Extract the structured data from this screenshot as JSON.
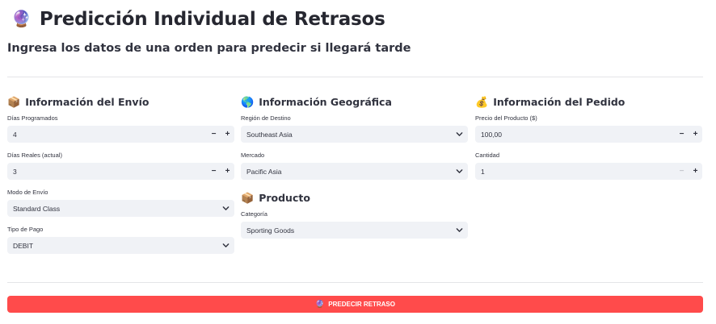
{
  "header": {
    "title_emoji": "🔮",
    "title": "Predicción Individual de Retrasos",
    "subtitle": "Ingresa los datos de una orden para predecir si llegará tarde"
  },
  "envio": {
    "emoji": "📦",
    "heading": "Información del Envío",
    "dias_programados": {
      "label": "Días Programados",
      "value": "4"
    },
    "dias_reales": {
      "label": "Días Reales (actual)",
      "value": "3"
    },
    "modo_envio": {
      "label": "Modo de Envío",
      "value": "Standard Class"
    },
    "tipo_pago": {
      "label": "Tipo de Pago",
      "value": "DEBIT"
    }
  },
  "geografica": {
    "emoji": "🌎",
    "heading": "Información Geográfica",
    "region": {
      "label": "Región de Destino",
      "value": "Southeast Asia"
    },
    "mercado": {
      "label": "Mercado",
      "value": "Pacific Asia"
    }
  },
  "producto": {
    "emoji": "📦",
    "heading": "Producto",
    "categoria": {
      "label": "Categoría",
      "value": "Sporting Goods"
    }
  },
  "pedido": {
    "emoji": "💰",
    "heading": "Información del Pedido",
    "precio": {
      "label": "Precio del Producto ($)",
      "value": "100,00"
    },
    "cantidad": {
      "label": "Cantidad",
      "value": "1"
    }
  },
  "stepper": {
    "minus": "−",
    "plus": "+"
  },
  "action": {
    "emoji": "🔮",
    "label": "PREDECIR RETRASO"
  },
  "colors": {
    "primary": "#ff4b4b",
    "field_bg": "#f0f2f6",
    "text": "#31333f"
  }
}
